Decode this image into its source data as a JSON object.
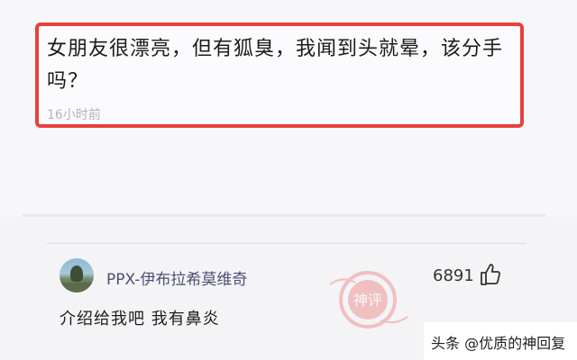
{
  "post": {
    "title": "女朋友很漂亮，但有狐臭，我闻到头就晕，该分手吗？",
    "time": "16小时前"
  },
  "comment": {
    "username": "PPX-伊布拉希莫维奇",
    "likes": "6891",
    "text": "介绍给我吧 我有鼻炎",
    "badge": "神评"
  },
  "watermark": {
    "text": "头条 @优质的神回复"
  },
  "colors": {
    "highlight_border": "#e8403b",
    "username": "#4b4f73",
    "badge": "#e8403b"
  },
  "icons": {
    "like": "thumbs-up-icon",
    "avatar": "avatar-image"
  }
}
